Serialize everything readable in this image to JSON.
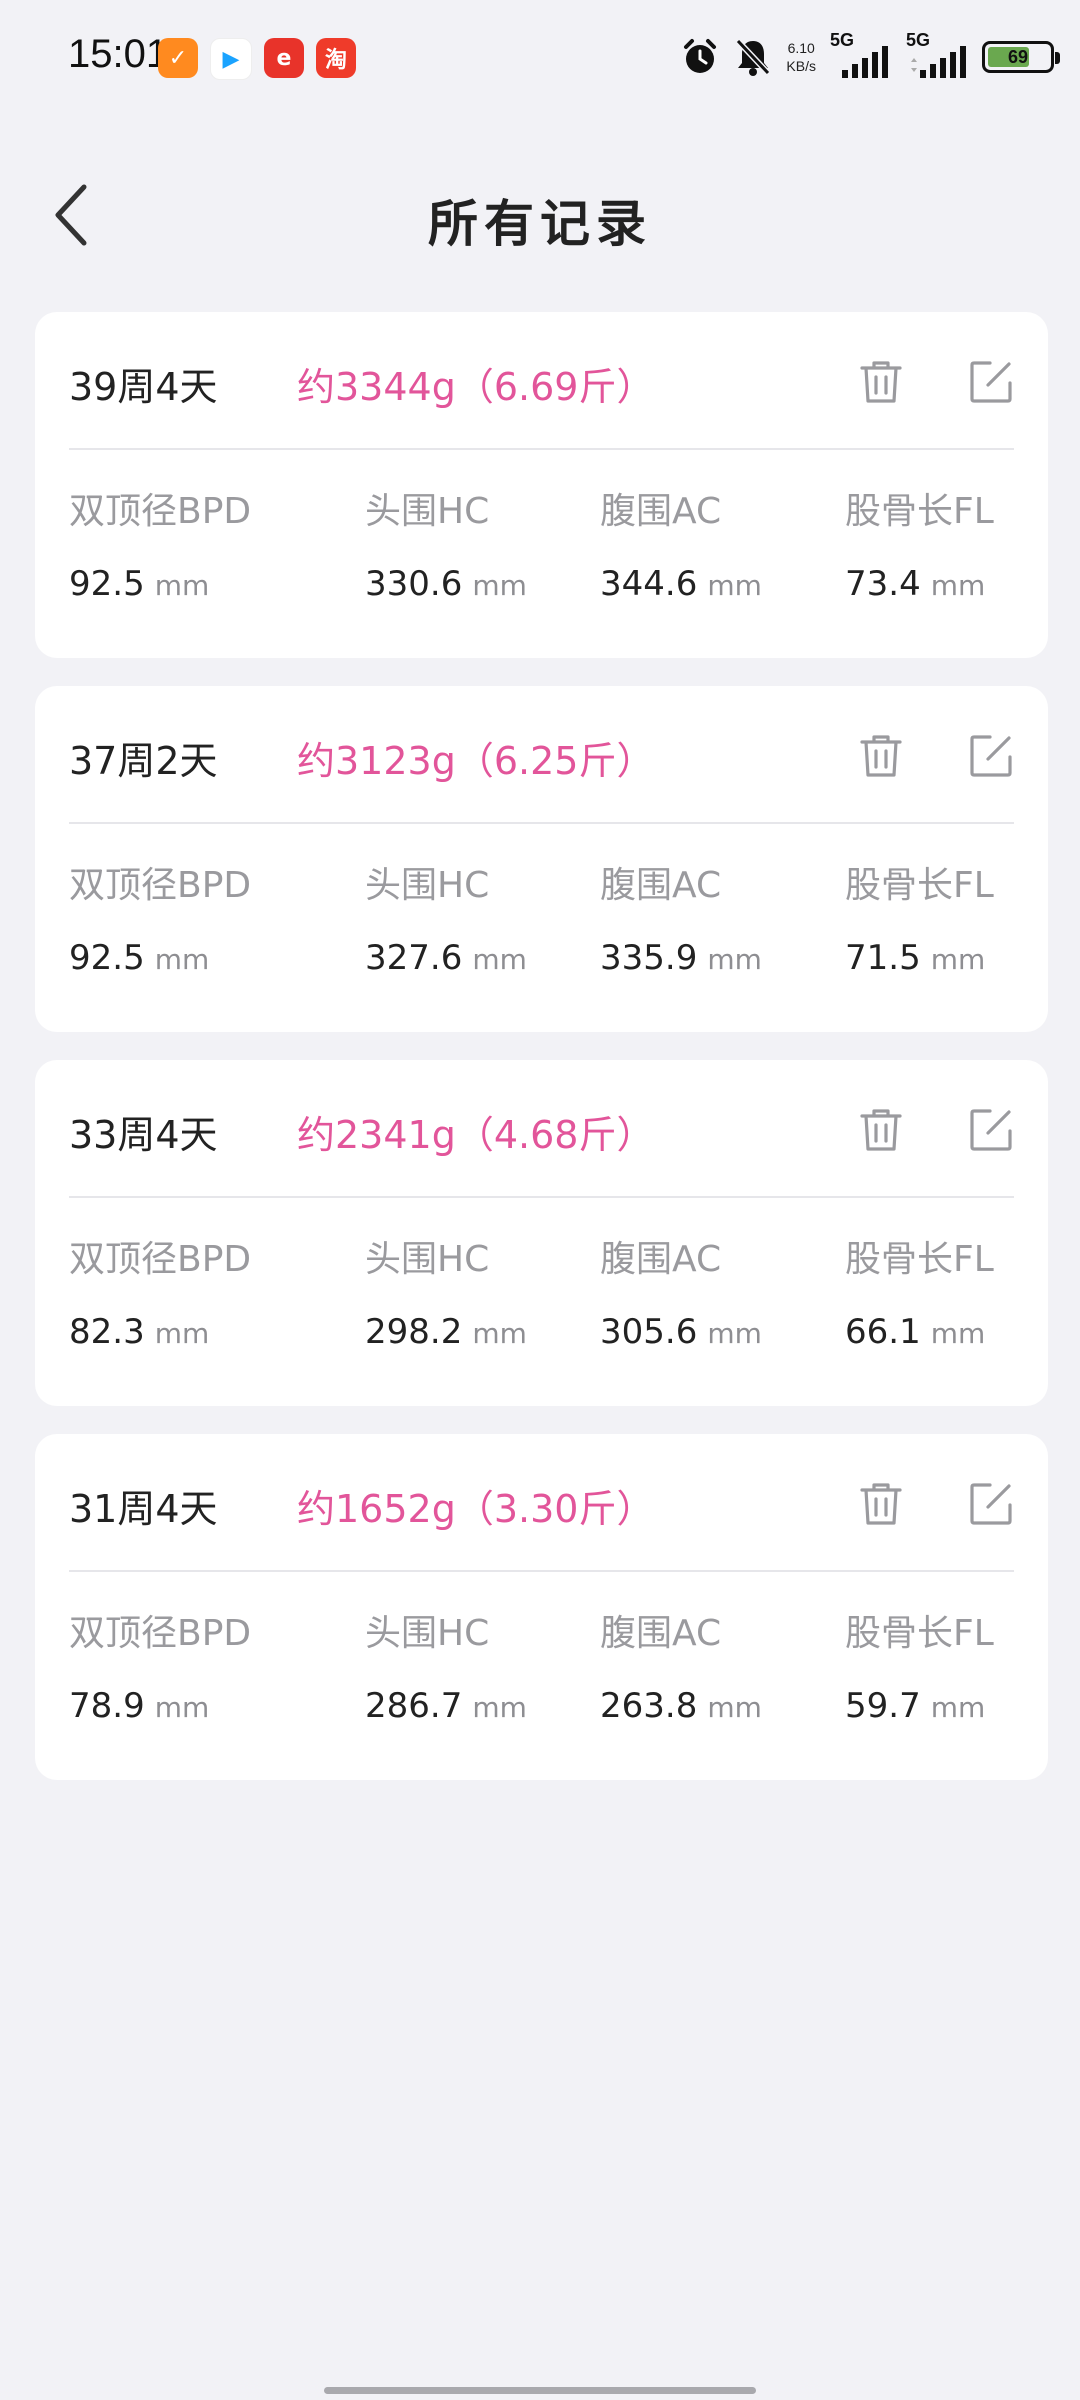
{
  "status_bar": {
    "time": "15:01",
    "net_speed_value": "6.10",
    "net_speed_unit": "KB/s",
    "sim1_label": "5G",
    "sim2_label": "5G",
    "battery_level": 69,
    "battery_text": "69",
    "apps": [
      {
        "name": "app-orange",
        "color": "#ff8a1f",
        "glyph": "✓"
      },
      {
        "name": "app-video",
        "color": "#ffffff",
        "glyph": "▶"
      },
      {
        "name": "app-red",
        "color": "#e8332a",
        "glyph": "e"
      },
      {
        "name": "app-taobao",
        "color": "#ef3b2a",
        "glyph": "淘"
      }
    ]
  },
  "header": {
    "title": "所有记录"
  },
  "colors": {
    "weight": "#e2559a",
    "background": "#f2f2f6",
    "card": "#ffffff"
  },
  "records": [
    {
      "gestational_age": "39周4天",
      "weight": "约3344g（6.69斤）",
      "metrics": [
        {
          "label": "双顶径BPD",
          "value": "92.5",
          "unit": "mm"
        },
        {
          "label": "头围HC",
          "value": "330.6",
          "unit": "mm"
        },
        {
          "label": "腹围AC",
          "value": "344.6",
          "unit": "mm"
        },
        {
          "label": "股骨长FL",
          "value": "73.4",
          "unit": "mm"
        }
      ]
    },
    {
      "gestational_age": "37周2天",
      "weight": "约3123g（6.25斤）",
      "metrics": [
        {
          "label": "双顶径BPD",
          "value": "92.5",
          "unit": "mm"
        },
        {
          "label": "头围HC",
          "value": "327.6",
          "unit": "mm"
        },
        {
          "label": "腹围AC",
          "value": "335.9",
          "unit": "mm"
        },
        {
          "label": "股骨长FL",
          "value": "71.5",
          "unit": "mm"
        }
      ]
    },
    {
      "gestational_age": "33周4天",
      "weight": "约2341g（4.68斤）",
      "metrics": [
        {
          "label": "双顶径BPD",
          "value": "82.3",
          "unit": "mm"
        },
        {
          "label": "头围HC",
          "value": "298.2",
          "unit": "mm"
        },
        {
          "label": "腹围AC",
          "value": "305.6",
          "unit": "mm"
        },
        {
          "label": "股骨长FL",
          "value": "66.1",
          "unit": "mm"
        }
      ]
    },
    {
      "gestational_age": "31周4天",
      "weight": "约1652g（3.30斤）",
      "metrics": [
        {
          "label": "双顶径BPD",
          "value": "78.9",
          "unit": "mm"
        },
        {
          "label": "头围HC",
          "value": "286.7",
          "unit": "mm"
        },
        {
          "label": "腹围AC",
          "value": "263.8",
          "unit": "mm"
        },
        {
          "label": "股骨长FL",
          "value": "59.7",
          "unit": "mm"
        }
      ]
    }
  ]
}
